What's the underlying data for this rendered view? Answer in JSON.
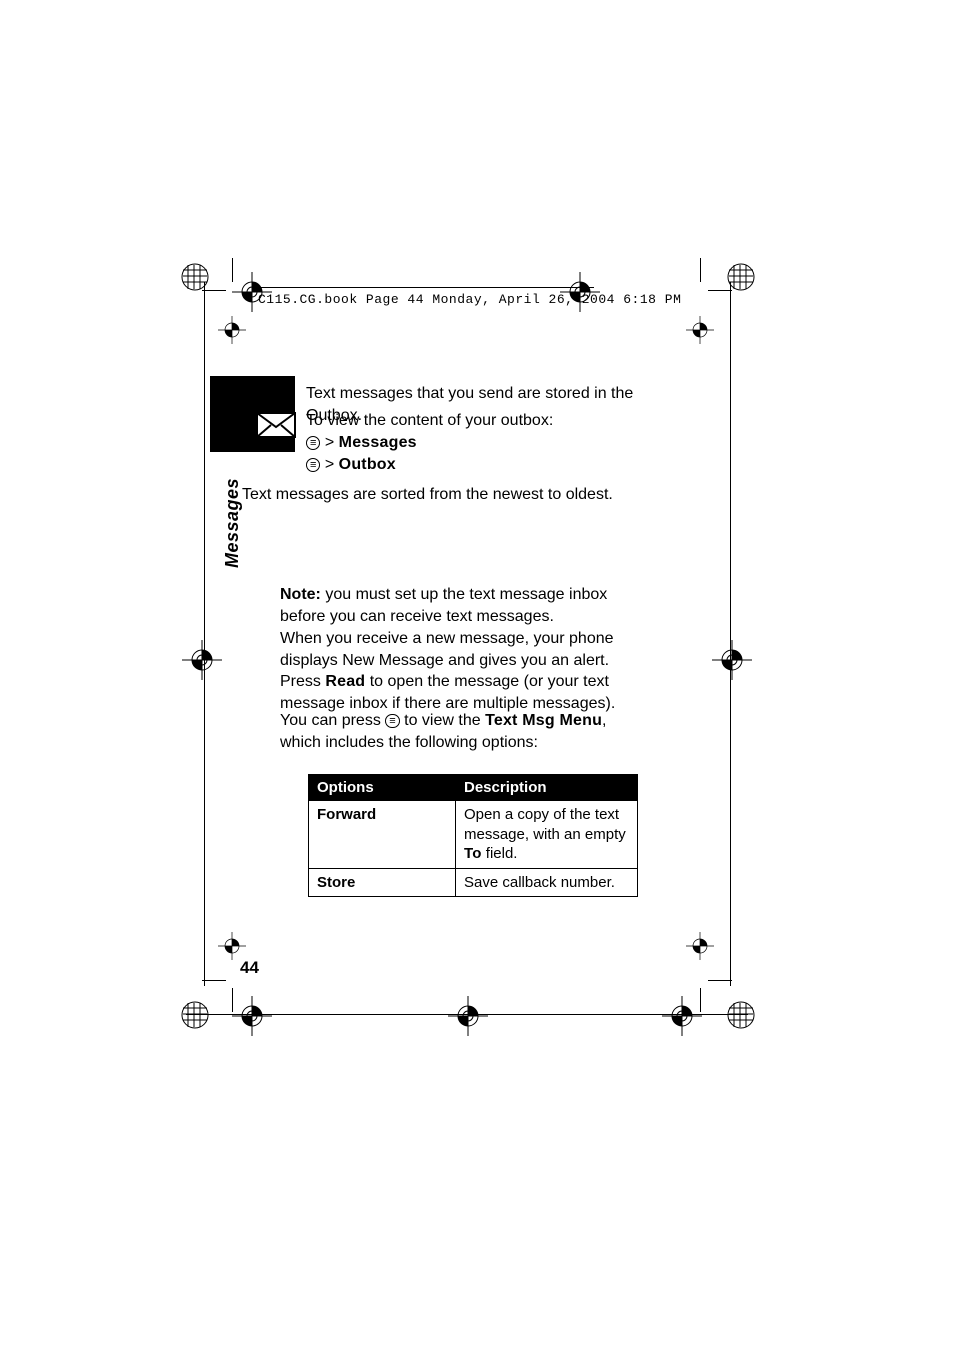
{
  "header": {
    "path_line": "C115.CG.book  Page 44  Monday, April 26, 2004  6:18 PM"
  },
  "side_label": "Messages",
  "intro": {
    "p1": "Text messages that you send are stored in the Outbox.",
    "p2": "To view the content of your outbox:"
  },
  "nav": {
    "sep": ">",
    "item1": "Messages",
    "item2": "Outbox"
  },
  "sorted_line": "Text messages are sorted from the newest to oldest.",
  "note": {
    "label": "Note:",
    "text": " you must set up the text message inbox before you can receive text messages."
  },
  "receive_para": {
    "pre": "When you receive a new message, your phone displays New Message and gives you an alert. Press ",
    "read": "Read",
    "post": " to open the message (or your text message inbox if there are multiple messages)."
  },
  "press_para": {
    "pre": "You can press ",
    "mid": " to view the ",
    "menu": "Text Msg Menu",
    "post": ", which includes the following options:"
  },
  "table": {
    "h1": "Options",
    "h2": "Description",
    "rows": [
      {
        "opt": "Forward",
        "desc_pre": "Open a copy of the text message, with an empty ",
        "desc_bold": "To",
        "desc_post": " field."
      },
      {
        "opt": "Store",
        "desc_pre": "Save callback number.",
        "desc_bold": "",
        "desc_post": ""
      }
    ]
  },
  "page_number": "44",
  "icons": {
    "menu_glyph": "≡",
    "envelope": "envelope-icon",
    "reg_target": "registration-target-icon",
    "reg_corner": "registration-corner-icon"
  }
}
